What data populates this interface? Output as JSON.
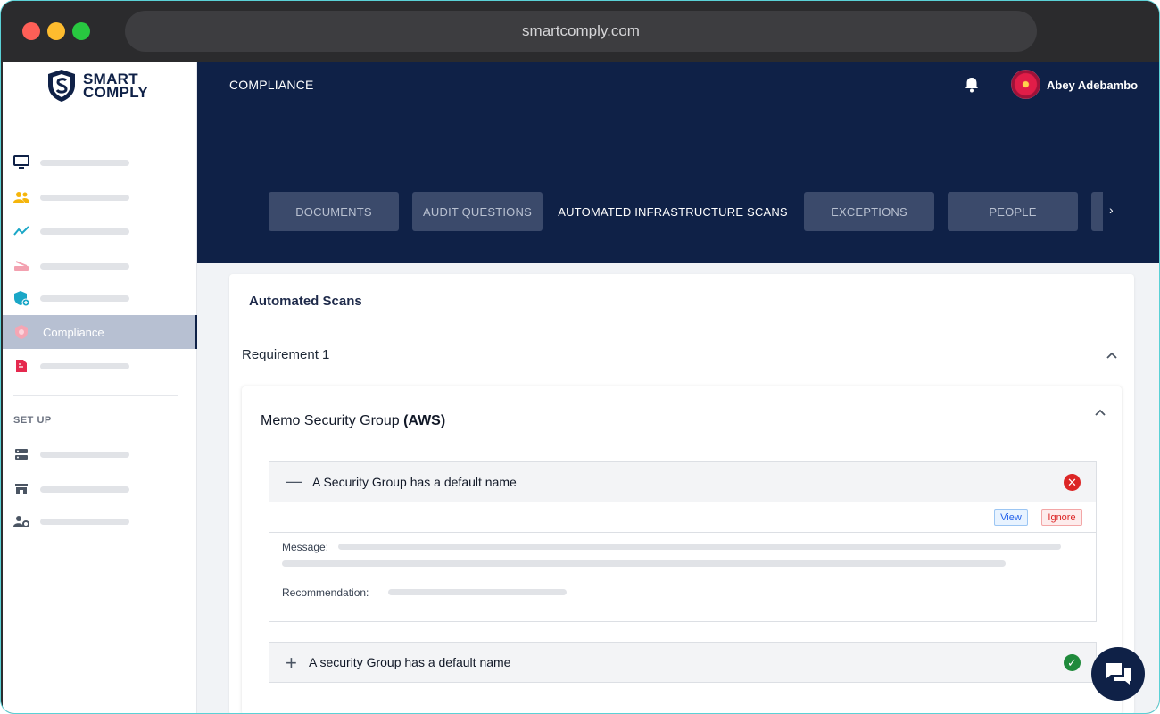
{
  "browser": {
    "url": "smartcomply.com"
  },
  "brand": {
    "line1": "SMART",
    "line2": "COMPLY"
  },
  "sidebar": {
    "items": [
      {
        "icon": "monitor-icon",
        "label": ""
      },
      {
        "icon": "users-icon",
        "label": ""
      },
      {
        "icon": "activity-icon",
        "label": ""
      },
      {
        "icon": "scanner-icon",
        "label": ""
      },
      {
        "icon": "shield-plus-icon",
        "label": ""
      },
      {
        "icon": "shield-icon",
        "label": "Compliance",
        "active": true
      },
      {
        "icon": "file-icon",
        "label": ""
      }
    ],
    "section_label": "SET UP",
    "setup_items": [
      {
        "icon": "server-icon",
        "label": ""
      },
      {
        "icon": "store-icon",
        "label": ""
      },
      {
        "icon": "user-settings-icon",
        "label": ""
      }
    ]
  },
  "header": {
    "title": "COMPLIANCE",
    "user_name": "Abey Adebambo",
    "tabs": [
      {
        "label": "DOCUMENTS"
      },
      {
        "label": "AUDIT QUESTIONS"
      },
      {
        "label": "AUTOMATED INFRASTRUCTURE SCANS",
        "active": true
      },
      {
        "label": "EXCEPTIONS"
      },
      {
        "label": "PEOPLE"
      },
      {
        "label": ""
      }
    ]
  },
  "main": {
    "card_title": "Automated Scans",
    "requirement": "Requirement 1",
    "group_title": "Memo Security Group",
    "group_provider": "(AWS)",
    "rules": [
      {
        "title": "A Security Group has a default name",
        "expanded": true,
        "status": "failed",
        "actions": {
          "view": "View",
          "ignore": "Ignore"
        },
        "message_label": "Message:",
        "recommendation_label": "Recommendation:"
      },
      {
        "title": "A security Group has a default name",
        "expanded": false,
        "status": "passed"
      }
    ]
  },
  "colors": {
    "navy": "#0f2147",
    "tab": "#3b4a6b",
    "fail": "#dc2626",
    "pass": "#1f8a3b",
    "active_nav": "#b7c0d2"
  }
}
